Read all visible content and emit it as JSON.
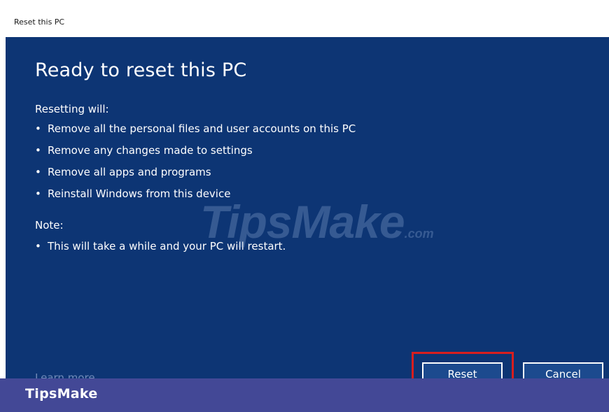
{
  "window": {
    "title": "Reset this PC"
  },
  "dialog": {
    "heading": "Ready to reset this PC",
    "intro": "Resetting will:",
    "bullet_symbol": "•",
    "bullets": [
      "Remove all the personal files and user accounts on this PC",
      "Remove any changes made to settings",
      "Remove all apps and programs",
      "Reinstall Windows from this device"
    ],
    "note_label": "Note:",
    "note_bullets": [
      "This will take a while and your PC will restart."
    ],
    "learn_more_link": "Learn more",
    "reset_button": "Reset",
    "cancel_button": "Cancel"
  },
  "watermark": {
    "main": "TipsMake",
    "suffix": ".com"
  },
  "brand_bar": {
    "label": "TipsMake"
  },
  "colors": {
    "dialog_background": "#0d3574",
    "highlight_outline": "#d81e1e",
    "brand_bar": "#434896"
  }
}
